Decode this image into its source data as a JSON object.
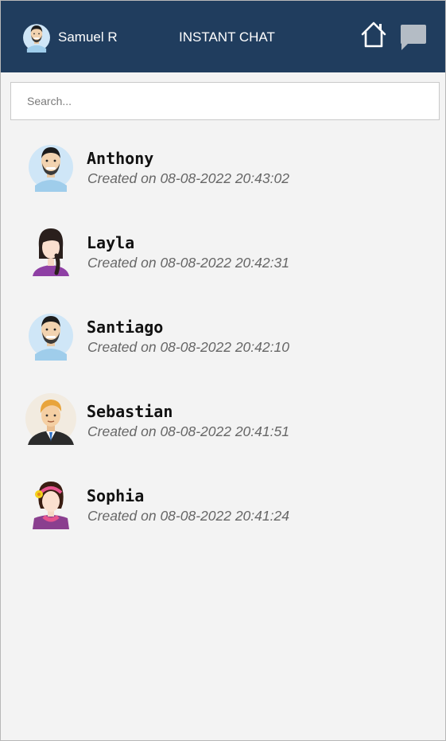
{
  "header": {
    "user_name": "Samuel R",
    "app_title": "INSTANT CHAT",
    "home_icon": "home-icon",
    "chat_icon": "chat-bubble-icon",
    "background_color": "#203d5e"
  },
  "search": {
    "placeholder": "Search...",
    "value": ""
  },
  "contacts": [
    {
      "name": "Anthony",
      "created": "Created on 08-08-2022 20:43:02",
      "avatar": "man-beard-avatar"
    },
    {
      "name": "Layla",
      "created": "Created on 08-08-2022 20:42:31",
      "avatar": "woman-braid-avatar"
    },
    {
      "name": "Santiago",
      "created": "Created on 08-08-2022 20:42:10",
      "avatar": "man-beard-avatar"
    },
    {
      "name": "Sebastian",
      "created": "Created on 08-08-2022 20:41:51",
      "avatar": "man-suit-avatar"
    },
    {
      "name": "Sophia",
      "created": "Created on 08-08-2022 20:41:24",
      "avatar": "woman-flower-avatar"
    }
  ]
}
